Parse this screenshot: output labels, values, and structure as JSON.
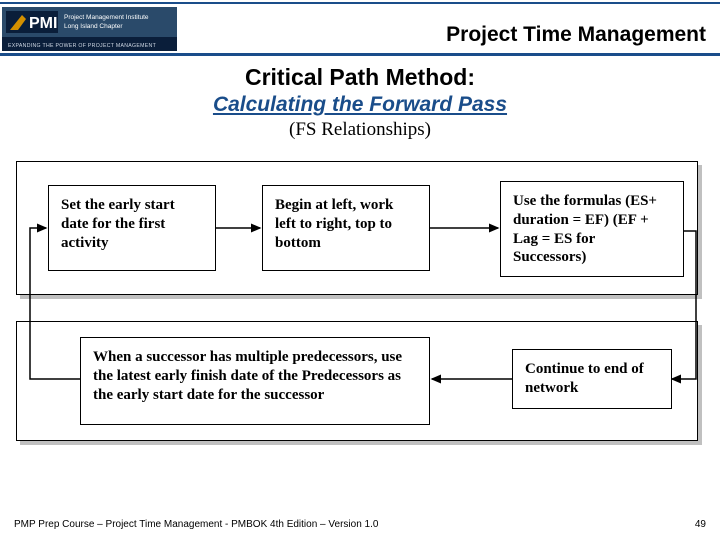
{
  "header": {
    "logo": {
      "pmi": "PMI",
      "line1": "Project Management Institute",
      "line2": "Long Island Chapter",
      "tagline": "EXPANDING THE POWER OF PROJECT MANAGEMENT"
    },
    "title": "Project Time Management"
  },
  "titles": {
    "main": "Critical Path Method:",
    "sub": "Calculating the Forward Pass",
    "paren": "(FS Relationships)"
  },
  "boxes": {
    "b1": "Set the early start date for the first activity",
    "b2": "Begin at left, work left to right, top to bottom",
    "b3": "Use the formulas (ES+ duration = EF) (EF + Lag = ES for Successors)",
    "b4": "When a successor has multiple predecessors, use the latest early finish date of the Predecessors as the early start date for the successor",
    "b5": "Continue to end of network"
  },
  "footer": {
    "left": "PMP Prep Course – Project Time Management - PMBOK 4th Edition – Version 1.0",
    "page": "49"
  }
}
